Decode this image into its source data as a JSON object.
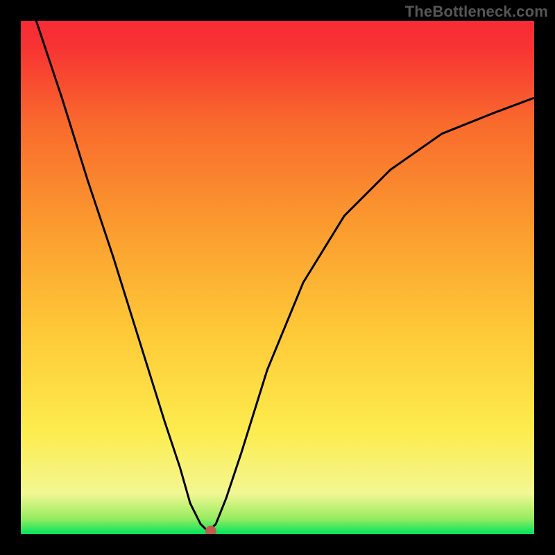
{
  "watermark": "TheBottleneck.com",
  "chart_data": {
    "type": "line",
    "title": "",
    "xlabel": "",
    "ylabel": "",
    "xlim": [
      0,
      100
    ],
    "ylim": [
      0,
      100
    ],
    "notes": "Notch/V-shaped bottleneck curve over vertical green→yellow→orange→red gradient background. No numeric axis tick labels are visible; x/y values below are estimated from pixel positions relative to the plot area, normalized 0–100.",
    "series": [
      {
        "name": "bottleneck-curve",
        "x": [
          3,
          8,
          13,
          18,
          23,
          28,
          31,
          33,
          35,
          36,
          37,
          38,
          40,
          43,
          48,
          55,
          63,
          72,
          82,
          92,
          100
        ],
        "y": [
          100,
          85,
          69,
          54,
          38,
          22,
          13,
          6,
          2,
          1,
          1,
          2,
          7,
          16,
          32,
          49,
          62,
          71,
          78,
          82,
          85
        ]
      }
    ],
    "marker": {
      "x": 37,
      "y": 0.6,
      "color": "#c15b4f",
      "radius_px": 8
    },
    "frame": {
      "stroke": "#000000",
      "stroke_width_px": 30
    },
    "background_gradient": {
      "direction": "vertical",
      "stops": [
        {
          "pos": 0.0,
          "color": "#00e35e"
        },
        {
          "pos": 0.03,
          "color": "#95ec60"
        },
        {
          "pos": 0.08,
          "color": "#f3f793"
        },
        {
          "pos": 0.2,
          "color": "#fdec4e"
        },
        {
          "pos": 0.4,
          "color": "#fec837"
        },
        {
          "pos": 0.6,
          "color": "#fb9b2f"
        },
        {
          "pos": 0.8,
          "color": "#f96a2d"
        },
        {
          "pos": 0.95,
          "color": "#f73333"
        },
        {
          "pos": 1.0,
          "color": "#f72b35"
        }
      ]
    }
  }
}
